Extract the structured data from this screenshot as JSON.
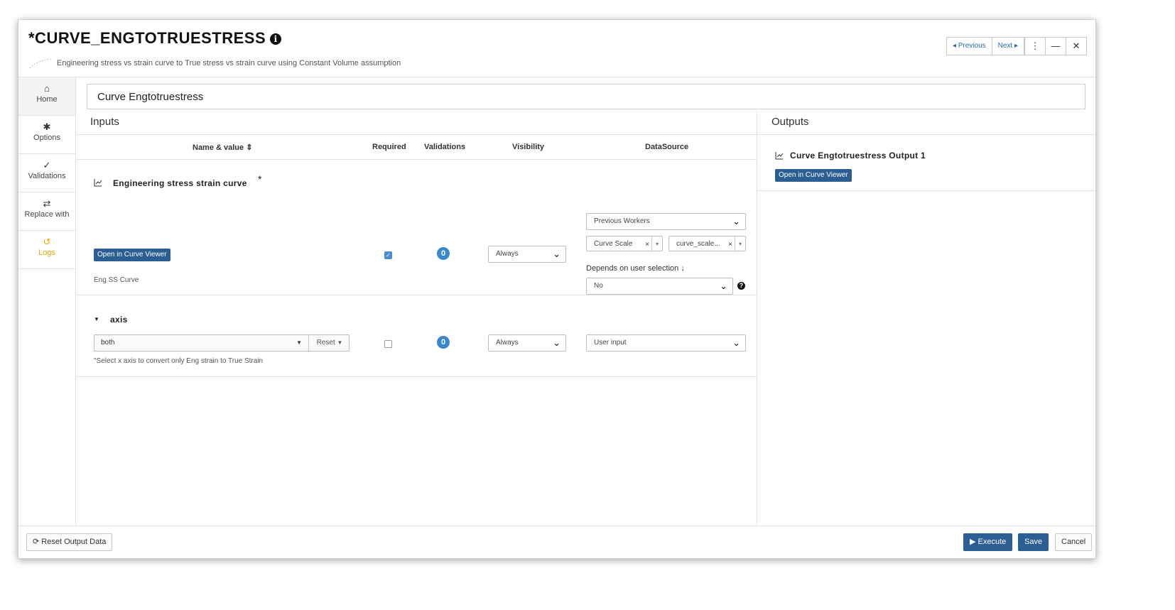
{
  "header": {
    "title": "*CURVE_ENGTOTRUESTRESS",
    "info_icon": "info-circle-icon",
    "subtitle": "Engineering stress vs strain curve to True stress vs strain curve using Constant Volume assumption",
    "prev_label": "Previous",
    "next_label": "Next"
  },
  "sidebar": {
    "items": [
      {
        "label": "Home",
        "icon": "home-icon"
      },
      {
        "label": "Options",
        "icon": "gear-icon"
      },
      {
        "label": "Validations",
        "icon": "check-icon"
      },
      {
        "label": "Replace with",
        "icon": "swap-arrows-icon"
      },
      {
        "label": "Logs",
        "icon": "history-icon"
      }
    ]
  },
  "name_field": "Curve Engtotruestress",
  "inputs": {
    "title": "Inputs",
    "columns": {
      "name_value": "Name & value",
      "required": "Required",
      "validations": "Validations",
      "visibility": "Visibility",
      "datasource": "DataSource"
    },
    "params": [
      {
        "name": "Engineering stress strain curve",
        "required_mark": "*",
        "button": "Open in Curve Viewer",
        "caption": "Eng SS Curve",
        "required": true,
        "validations": "0",
        "visibility": "Always",
        "datasource": "Previous Workers",
        "tag1": "Curve Scale",
        "tag2": "curve_scale...",
        "depends_label": "Depends on user selection",
        "depends_value": "No"
      },
      {
        "name": "axis",
        "value": "both",
        "reset_label": "Reset",
        "hint": "\"Select x axis to convert only Eng strain to True Strain",
        "required": false,
        "validations": "0",
        "visibility": "Always",
        "datasource": "User input"
      }
    ]
  },
  "outputs": {
    "title": "Outputs",
    "items": [
      {
        "name": "Curve Engtotruestress Output 1",
        "button": "Open in Curve Viewer"
      }
    ]
  },
  "footer": {
    "reset_output": "Reset Output Data",
    "execute": "Execute",
    "save": "Save",
    "cancel": "Cancel"
  },
  "colors": {
    "primary": "#2b5e93",
    "badge": "#3a87cf",
    "logs_accent": "#f0a400"
  }
}
